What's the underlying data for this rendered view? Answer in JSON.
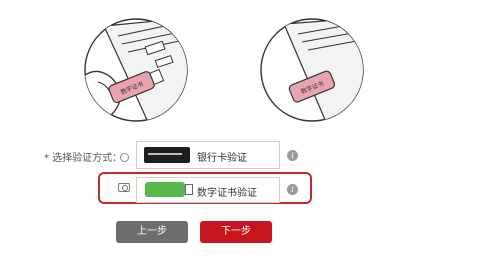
{
  "usb_key_label": "数字证书",
  "verify_method": {
    "label": "* 选择验证方式：",
    "options": [
      {
        "label": "银行卡验证",
        "selected": false
      },
      {
        "label": "数字证书验证",
        "selected": true
      }
    ],
    "info_icon": "i"
  },
  "buttons": {
    "prev": "上一步",
    "next": "下一步"
  },
  "colors": {
    "accent": "#c4161c",
    "secondary_button": "#6d6d6d",
    "usb_key_pink": "#e8a3ae",
    "usb_key_green": "#59b84c"
  }
}
